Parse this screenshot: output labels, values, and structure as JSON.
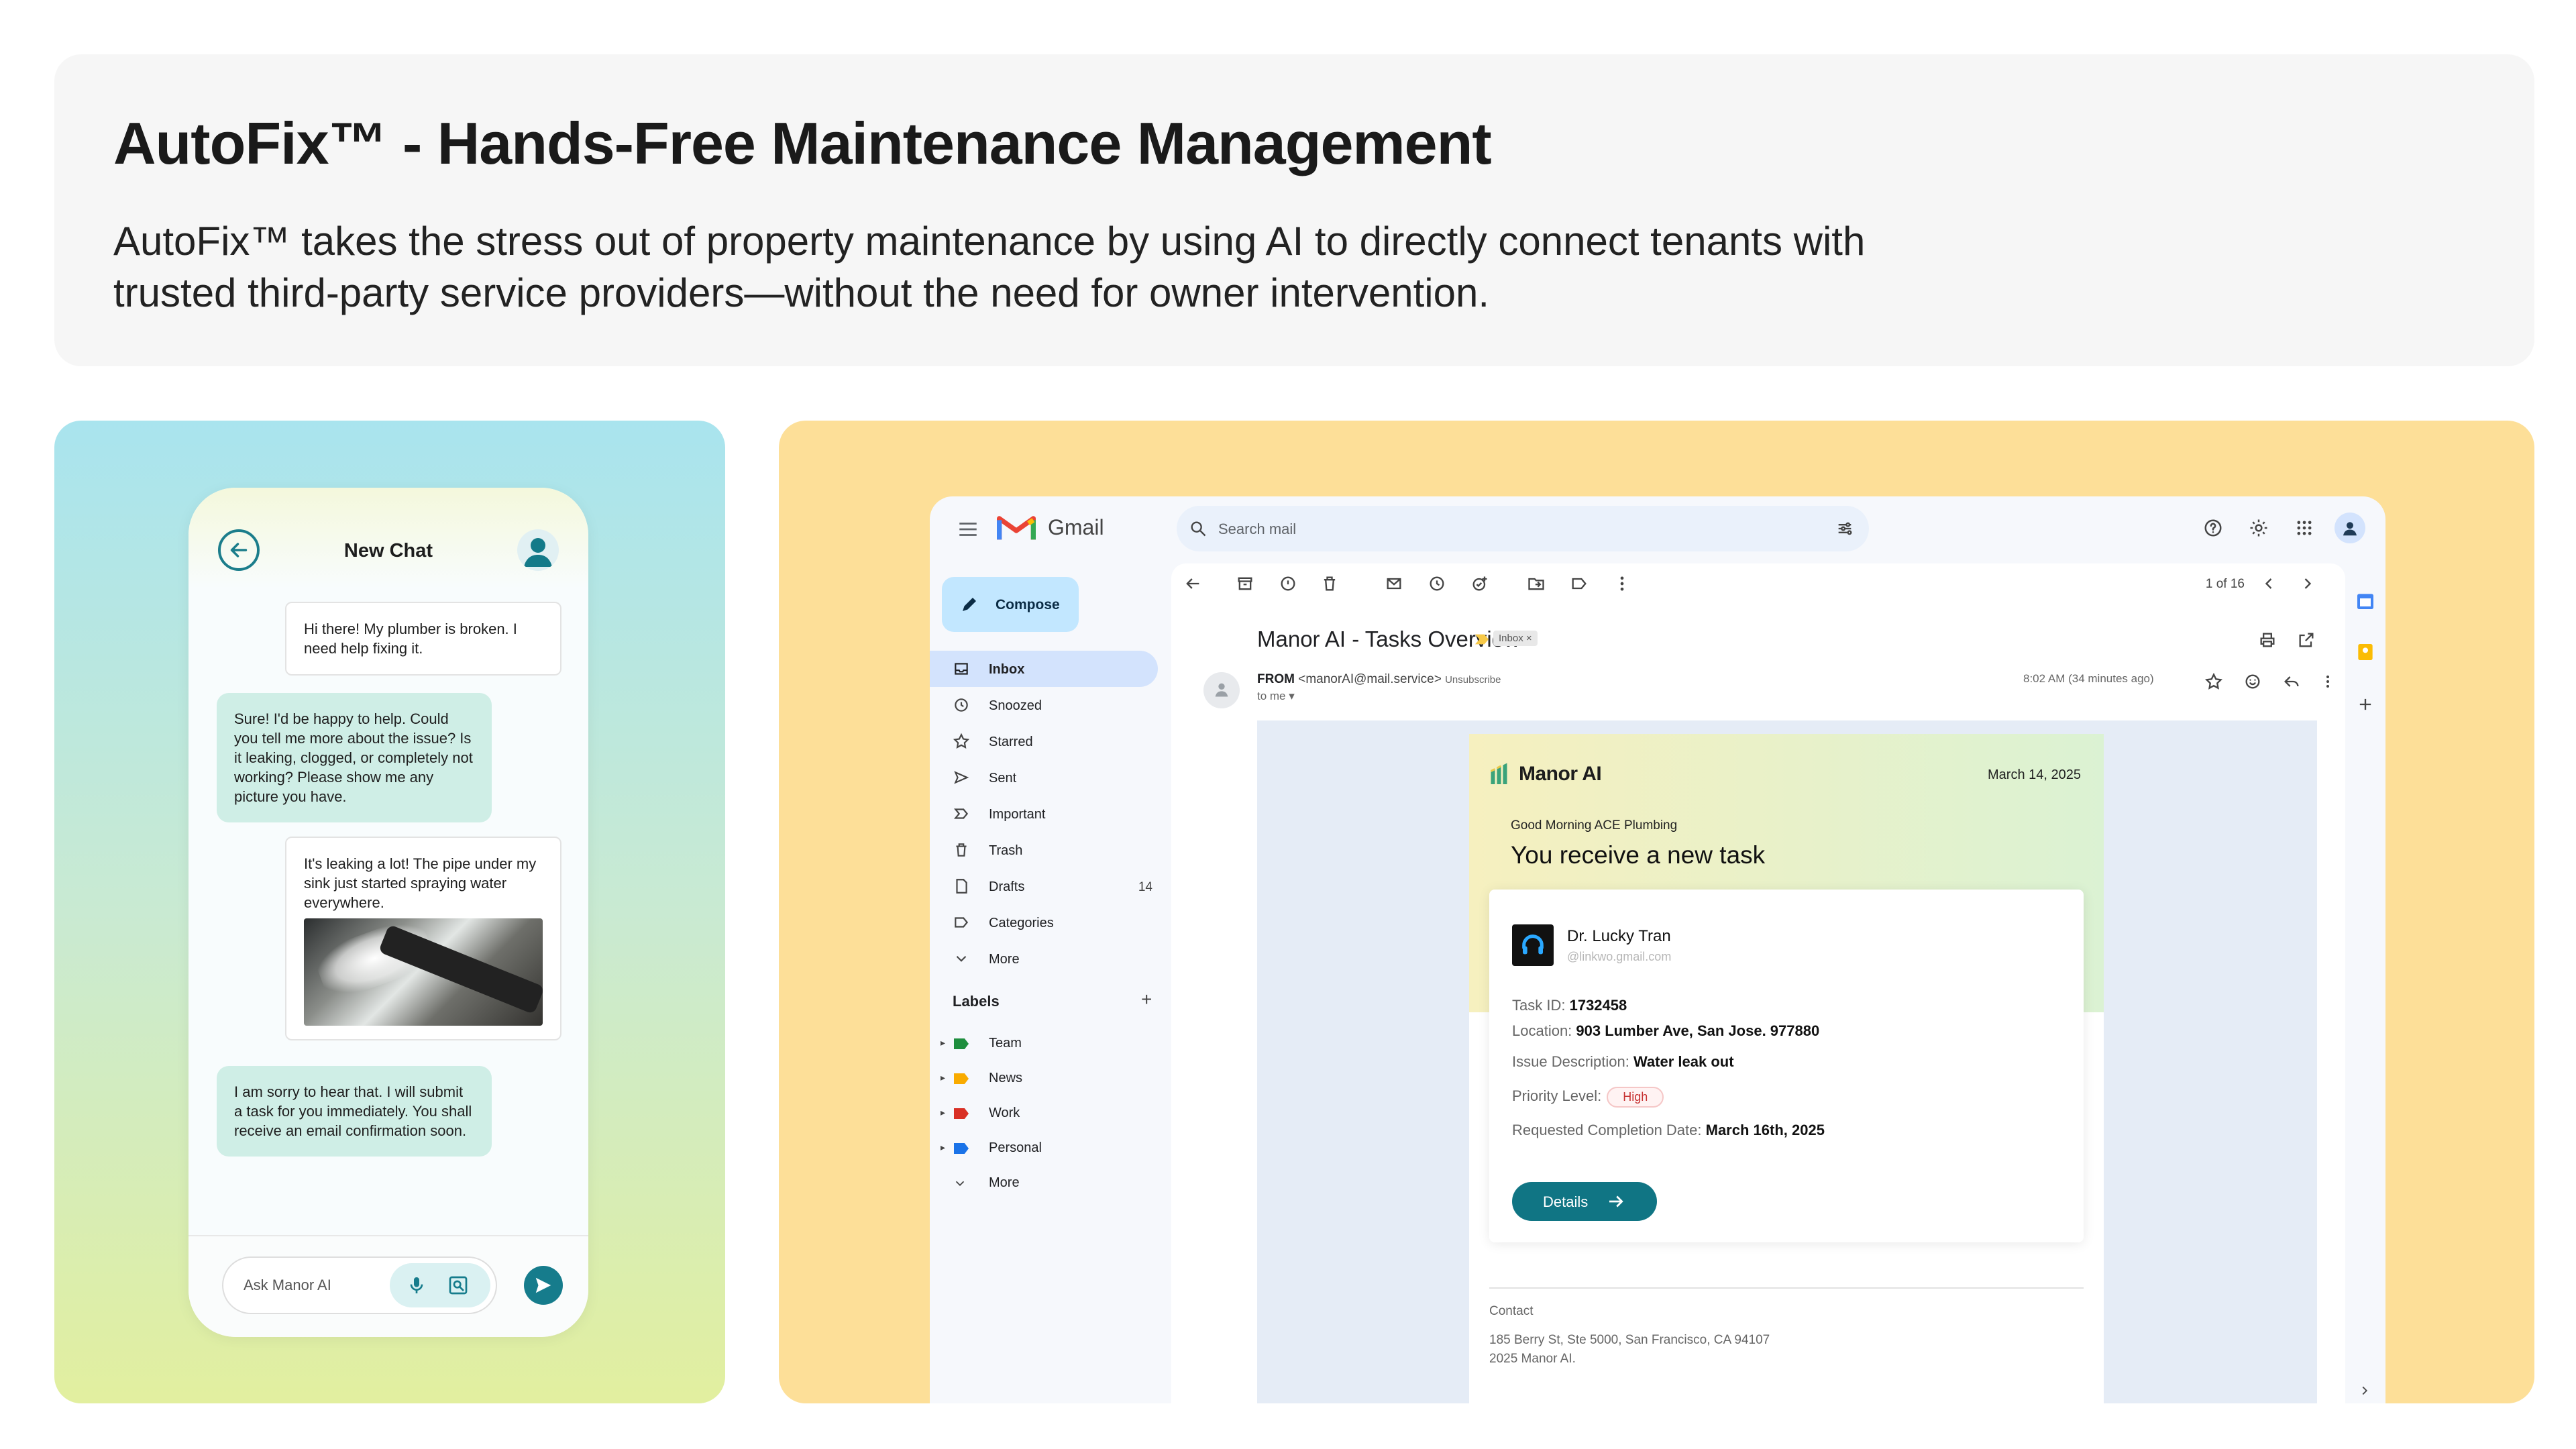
{
  "hero": {
    "title": "AutoFix™ - Hands-Free Maintenance Management",
    "description": "AutoFix™ takes the stress out of property maintenance by using AI to directly connect tenants with trusted third-party service providers—without the need for owner intervention."
  },
  "chat": {
    "title": "New Chat",
    "messages": [
      {
        "role": "user",
        "text": "Hi there! My plumber is broken. I need help fixing it."
      },
      {
        "role": "ai",
        "text": "Sure! I'd be happy to help. Could you tell me more about the issue? Is it leaking, clogged, or completely not working? Please show me any picture you have."
      },
      {
        "role": "user",
        "text": "It's leaking a lot! The pipe under my sink just started spraying water everywhere."
      },
      {
        "role": "ai",
        "text": "I am sorry to hear that. I will submit a task for you immediately. You shall receive an email confirmation soon."
      }
    ],
    "input_placeholder": "Ask Manor AI"
  },
  "gmail": {
    "app_name": "Gmail",
    "search_placeholder": "Search mail",
    "compose_label": "Compose",
    "nav": [
      {
        "label": "Inbox",
        "icon": "inbox-icon",
        "active": true
      },
      {
        "label": "Snoozed",
        "icon": "clock-icon"
      },
      {
        "label": "Starred",
        "icon": "star-icon"
      },
      {
        "label": "Sent",
        "icon": "send-icon"
      },
      {
        "label": "Important",
        "icon": "important-icon"
      },
      {
        "label": "Trash",
        "icon": "trash-icon"
      },
      {
        "label": "Drafts",
        "icon": "file-icon",
        "count": "14"
      },
      {
        "label": "Categories",
        "icon": "label-icon"
      },
      {
        "label": "More",
        "icon": "chevron-down-icon"
      }
    ],
    "labels_title": "Labels",
    "labels": [
      {
        "label": "Team",
        "color": "#1e8e3e"
      },
      {
        "label": "News",
        "color": "#f9ab00"
      },
      {
        "label": "Work",
        "color": "#d93025"
      },
      {
        "label": "Personal",
        "color": "#1a73e8"
      },
      {
        "label": "More",
        "color": ""
      }
    ],
    "pager": "1 of 16",
    "email": {
      "subject": "Manor AI - Tasks Overview",
      "chip": "Inbox ×",
      "from_label": "FROM",
      "from_address": "<manorAI@mail.service>",
      "unsubscribe": "Unsubscribe",
      "to": "to me ▾",
      "time": "8:02 AM (34 minutes ago)",
      "brand": "Manor AI",
      "date": "March 14, 2025",
      "greeting": "Good Morning ACE Plumbing",
      "headline": "You receive a new task",
      "client_name": "Dr. Lucky Tran",
      "client_email": "@linkwo.gmail.com",
      "fields": {
        "task_id_label": "Task ID:",
        "task_id": "1732458",
        "location_label": "Location:",
        "location": "903 Lumber Ave, San Jose. 977880",
        "issue_label": "Issue Description:",
        "issue": "Water leak out",
        "priority_label": "Priority Level:",
        "priority": "High",
        "completion_label": "Requested Completion Date:",
        "completion": "March 16th, 2025"
      },
      "details_label": "Details",
      "contact_label": "Contact",
      "address_line1": "185 Berry St, Ste 5000, San Francisco, CA 94107",
      "address_line2": "2025 Manor AI."
    }
  },
  "colors": {
    "accent_teal": "#107584",
    "left_panel_top": "#a9e4ee",
    "left_panel_bottom": "#e2ef9f",
    "right_panel": "#fddf98",
    "priority_red": "#c73131"
  }
}
